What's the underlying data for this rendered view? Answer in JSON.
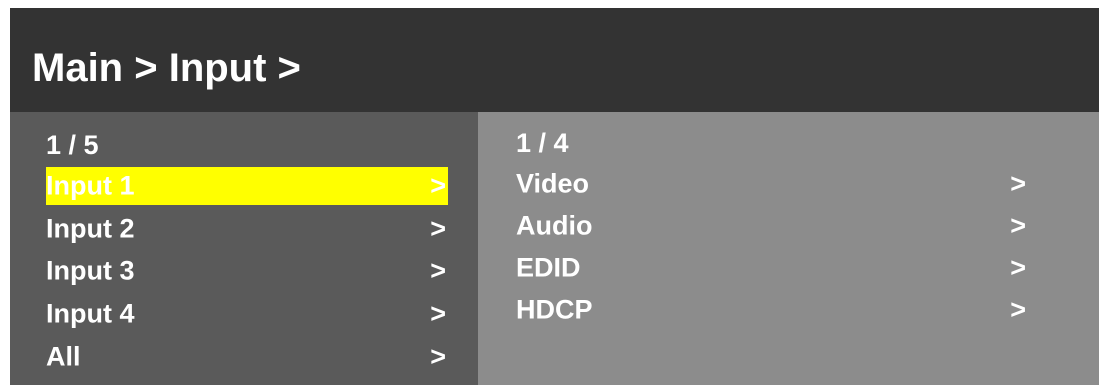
{
  "header": {
    "title": "Main > Input >"
  },
  "left_menu": {
    "counter": "1 / 5",
    "items": [
      {
        "label": "Input 1",
        "arrow": ">",
        "selected": true
      },
      {
        "label": "Input 2",
        "arrow": ">"
      },
      {
        "label": "Input 3",
        "arrow": ">"
      },
      {
        "label": "Input 4",
        "arrow": ">"
      },
      {
        "label": "All",
        "arrow": ">"
      }
    ]
  },
  "right_menu": {
    "counter": "1 / 4",
    "items": [
      {
        "label": "Video",
        "arrow": ">"
      },
      {
        "label": "Audio",
        "arrow": ">"
      },
      {
        "label": "EDID",
        "arrow": ">"
      },
      {
        "label": "HDCP",
        "arrow": ">"
      }
    ]
  },
  "colors": {
    "header_bg": "#333333",
    "left_pane_bg": "#5a5a5a",
    "right_pane_bg": "#8c8c8c",
    "selection_highlight": "#ffff00",
    "text": "#ffffff"
  }
}
